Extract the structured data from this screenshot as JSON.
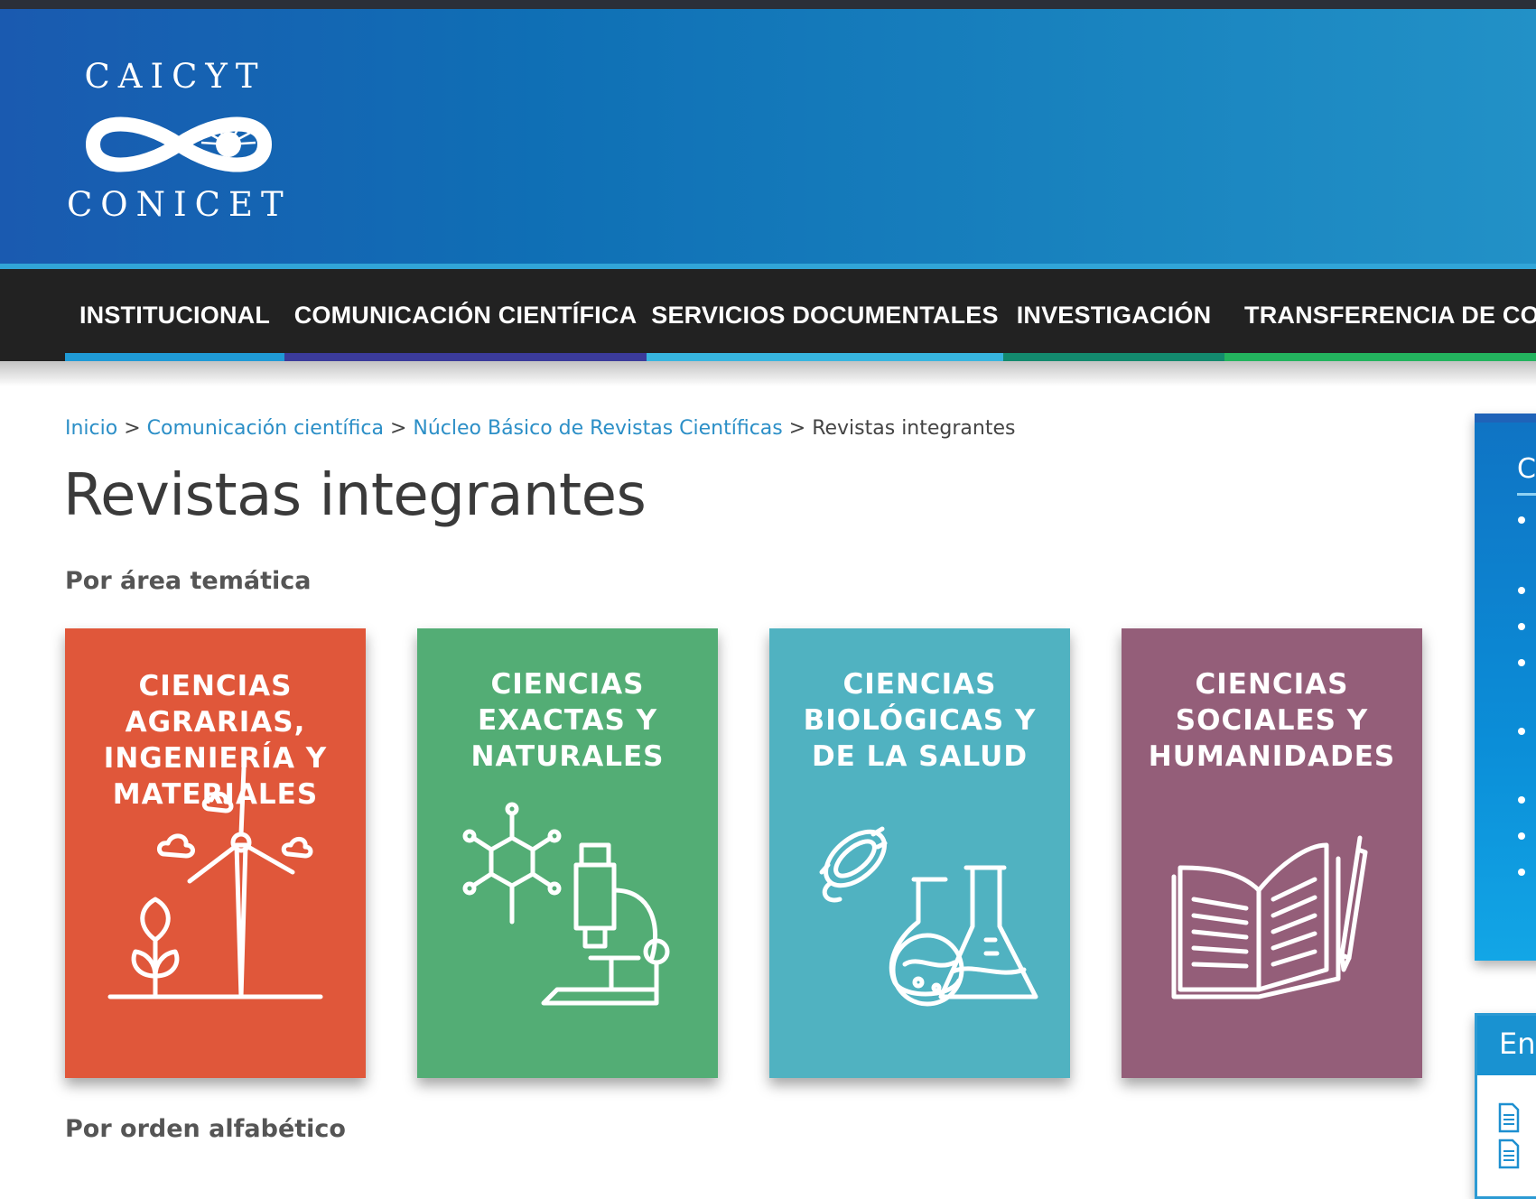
{
  "header": {
    "logo_top": "CAICYT",
    "logo_bottom": "CONICET"
  },
  "nav": {
    "items": [
      {
        "label": "INSTITUCIONAL",
        "color": "#1f9ad6"
      },
      {
        "label": "COMUNICACIÓN CIENTÍFICA",
        "color": "#3b3b9b"
      },
      {
        "label": "SERVICIOS DOCUMENTALES",
        "color": "#37b5df"
      },
      {
        "label": "INVESTIGACIÓN",
        "color": "#138a6e"
      },
      {
        "label": "TRANSFERENCIA DE CONC",
        "color": "#23b35e"
      }
    ]
  },
  "breadcrumb": {
    "items": [
      "Inicio",
      "Comunicación científica",
      "Núcleo Básico de Revistas Científicas"
    ],
    "separator": ">",
    "current": "Revistas integrantes"
  },
  "page": {
    "title": "Revistas integrantes",
    "section_area": "Por área temática",
    "section_alpha": "Por orden alfabético"
  },
  "cards": [
    {
      "title": "CIENCIAS\nAGRARIAS,\nINGENIERÍA Y\nMATERIALES",
      "color": "#e0573a",
      "icon": "wind-turbine-plant-icon"
    },
    {
      "title": "CIENCIAS\nEXACTAS Y\nNATURALES",
      "color": "#53ad75",
      "icon": "microscope-molecule-icon"
    },
    {
      "title": "CIENCIAS\nBIOLÓGICAS Y\nDE LA SALUD",
      "color": "#50b2c1",
      "icon": "flask-bacteria-icon"
    },
    {
      "title": "CIENCIAS\nSOCIALES Y\nHUMANIDADES",
      "color": "#945e79",
      "icon": "open-book-pencil-icon"
    }
  ],
  "sidebar": {
    "box1_heading": "C",
    "box2_heading": "En"
  }
}
